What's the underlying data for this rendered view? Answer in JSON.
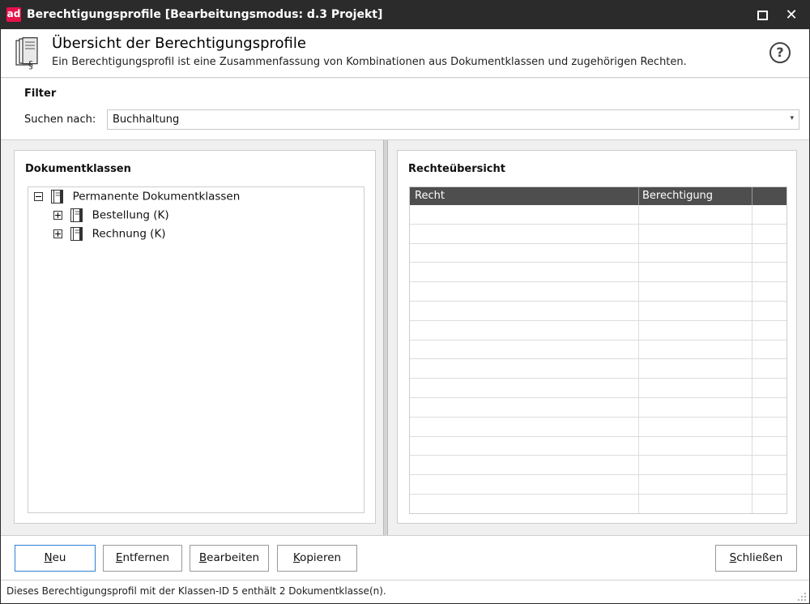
{
  "window": {
    "logo": "ad",
    "title": "Berechtigungsprofile [Bearbeitungsmodus: d.3 Projekt]",
    "close_glyph": "✕"
  },
  "header": {
    "title": "Übersicht der Berechtigungsprofile",
    "subtitle": "Ein Berechtigungsprofil ist eine Zusammenfassung von Kombinationen aus Dokumentklassen und zugehörigen Rechten.",
    "help_glyph": "?"
  },
  "filter": {
    "title": "Filter",
    "search_label": "Suchen nach:",
    "search_value": "Buchhaltung",
    "arrow_glyph": "▾"
  },
  "doc_classes": {
    "title": "Dokumentklassen",
    "tree": [
      {
        "label": "Permanente Dokumentklassen",
        "expanded": true,
        "level": 0
      },
      {
        "label": "Bestellung (K)",
        "expanded": false,
        "level": 1
      },
      {
        "label": "Rechnung (K)",
        "expanded": false,
        "level": 1
      }
    ]
  },
  "rights": {
    "title": "Rechteübersicht",
    "columns": [
      "Recht",
      "Berechtigung",
      ""
    ],
    "rows": []
  },
  "buttons": {
    "new": {
      "mnemonic": "N",
      "rest": "eu"
    },
    "remove": {
      "mnemonic": "E",
      "rest": "ntfernen"
    },
    "edit": {
      "mnemonic": "B",
      "rest": "earbeiten"
    },
    "copy": {
      "mnemonic": "K",
      "rest": "opieren"
    },
    "close": {
      "mnemonic": "S",
      "rest": "chließen"
    }
  },
  "status": {
    "text": "Dieses Berechtigungsprofil mit der Klassen-ID 5 enthält 2 Dokumentklasse(n)."
  }
}
